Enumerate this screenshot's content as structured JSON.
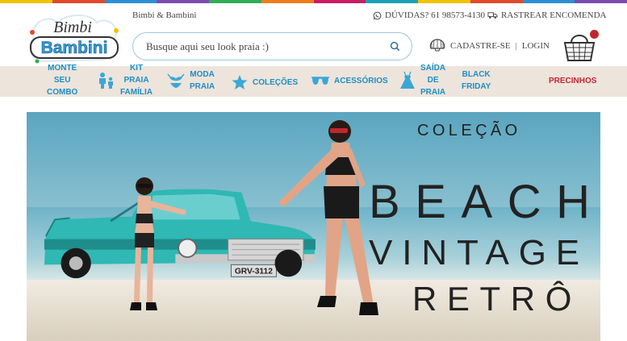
{
  "topbar_colors": [
    "#f2c200",
    "#e24a2b",
    "#2b8fd6",
    "#7a4bb0",
    "#2fae56",
    "#ef7d1a",
    "#c91c63",
    "#18a1b5",
    "#f2c200",
    "#e24a2b",
    "#2b8fd6",
    "#7a4bb0"
  ],
  "header": {
    "brand": "Bimbi & Bambini",
    "logo": {
      "line1": "Bimbi",
      "line2": "Bambini"
    },
    "help": {
      "icon": "whatsapp-icon",
      "label": "DÚVIDAS? 61 98573-4130"
    },
    "track": {
      "icon": "truck-icon",
      "label": "RASTREAR ENCOMENDA"
    },
    "search": {
      "placeholder": "Busque aqui seu look praia :)",
      "icon": "search-icon"
    },
    "account": {
      "icon": "shell-icon",
      "register": "CADASTRE-SE",
      "separator": "|",
      "login": "LOGIN"
    },
    "cart": {
      "icon": "basket-icon"
    }
  },
  "nav": [
    {
      "label_lines": [
        "MONTE",
        "SEU",
        "COMBO"
      ],
      "icon": ""
    },
    {
      "label_lines": [
        "KIT",
        "PRAIA",
        "FAMÍLIA"
      ],
      "icon": "family-icon"
    },
    {
      "label_lines": [
        "MODA",
        "PRAIA"
      ],
      "icon": "bikini-icon"
    },
    {
      "label_lines": [
        "COLEÇÕES"
      ],
      "icon": "starfish-icon"
    },
    {
      "label_lines": [
        "ACESSÓRIOS"
      ],
      "icon": "sunglasses-icon"
    },
    {
      "label_lines": [
        "SAÍDA",
        "DE",
        "PRAIA"
      ],
      "icon": "dress-icon"
    },
    {
      "label_lines": [
        "BLACK",
        "FRIDAY"
      ],
      "icon": ""
    },
    {
      "label_lines": [
        "PRECINHOS"
      ],
      "icon": ""
    }
  ],
  "banner": {
    "line1": "COLEÇÃO",
    "line2": "BEACH",
    "line3": "VINTAGE",
    "line4": "RETRÔ",
    "plate": "GRV-3112"
  },
  "colors": {
    "nav_text": "#1d8fc3",
    "nav_bg": "#ede4dc",
    "accent_red": "#c0272d"
  }
}
